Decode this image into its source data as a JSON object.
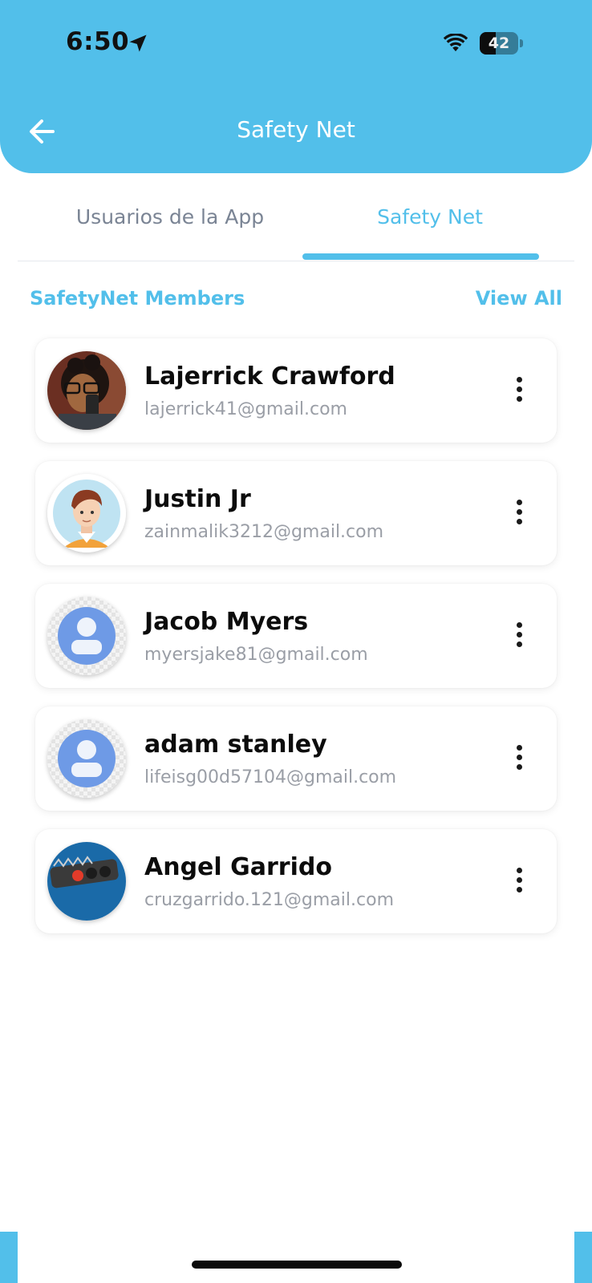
{
  "status_bar": {
    "time": "6:50",
    "battery_level": "42",
    "battery_fraction": 0.42,
    "icons": [
      "location-arrow-icon",
      "wifi-icon",
      "battery-icon"
    ]
  },
  "header": {
    "title": "Safety Net",
    "back_icon": "arrow-left-icon",
    "color": "#52bfea"
  },
  "tabs": [
    {
      "label": "Usuarios de la App",
      "active": false
    },
    {
      "label": "Safety Net",
      "active": true
    }
  ],
  "section": {
    "title": "SafetyNet Members",
    "view_all_label": "View All"
  },
  "members": [
    {
      "name": "Lajerrick Crawford",
      "email": "lajerrick41@gmail.com",
      "avatar": "photo"
    },
    {
      "name": "Justin Jr",
      "email": "zainmalik3212@gmail.com",
      "avatar": "cartoon"
    },
    {
      "name": "Jacob Myers",
      "email": "myersjake81@gmail.com",
      "avatar": "default"
    },
    {
      "name": "adam stanley",
      "email": "lifeisg00d57104@gmail.com",
      "avatar": "default"
    },
    {
      "name": "Angel Garrido",
      "email": "cruzgarrido.121@gmail.com",
      "avatar": "traffic-light"
    }
  ],
  "colors": {
    "accent": "#52bfea",
    "inactive_tab": "#7a8494",
    "email_text": "#9a9ea6"
  }
}
